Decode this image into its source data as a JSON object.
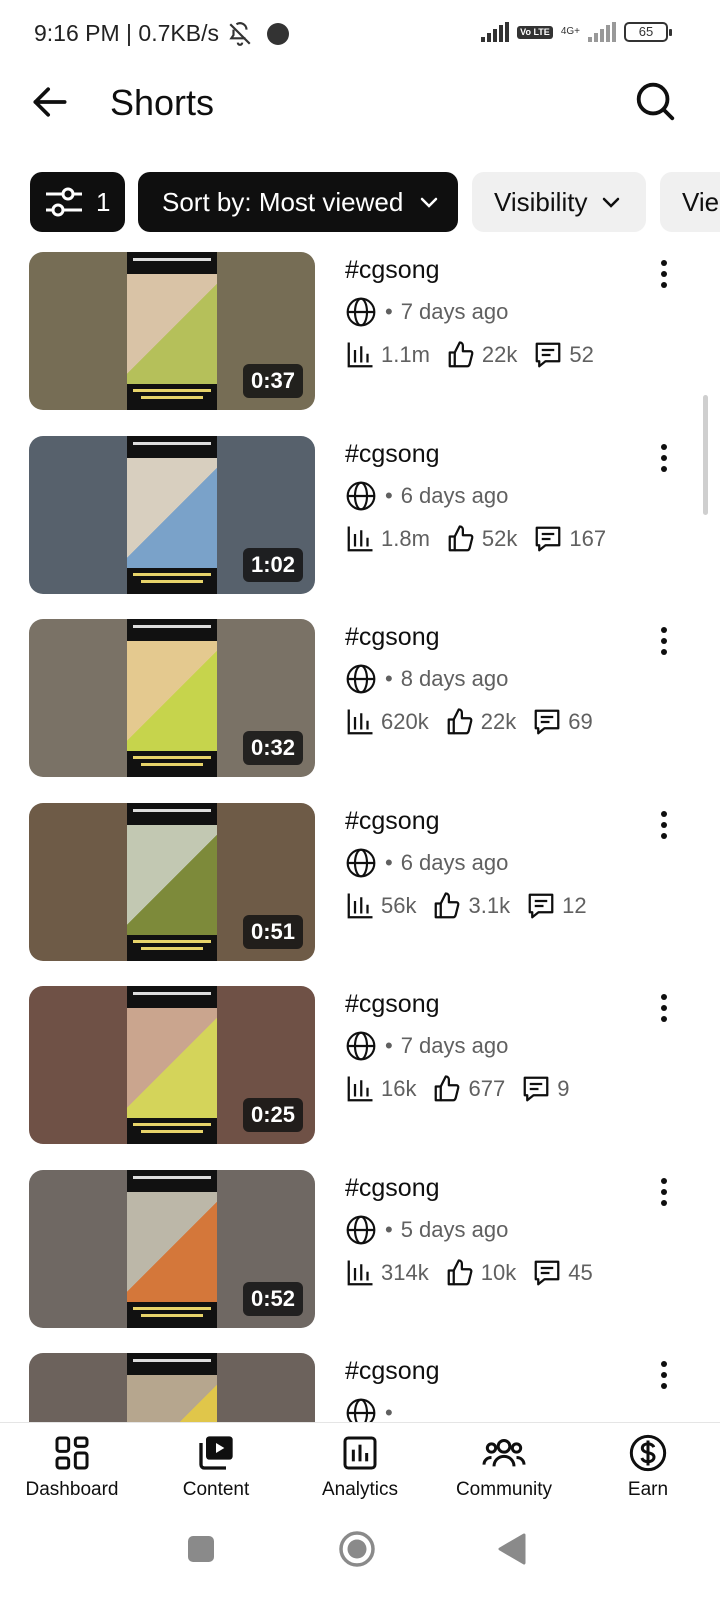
{
  "status_bar": {
    "time_and_speed": "9:16 PM | 0.7KB/s",
    "network": "4G+",
    "volte": "Vo LTE",
    "battery": "65"
  },
  "header": {
    "title": "Shorts"
  },
  "chips": {
    "filter_count": "1",
    "sort_label": "Sort by: Most viewed",
    "visibility_label": "Visibility",
    "views_label": "Vie"
  },
  "videos": [
    {
      "title": "#cgsong",
      "visibility_icon": "globe-icon",
      "age": "7 days ago",
      "duration": "0:37",
      "views": "1.1m",
      "likes": "22k",
      "comments": "52",
      "colors": [
        "#766d55",
        "#d9c3a6",
        "#b5c05a"
      ]
    },
    {
      "title": "#cgsong",
      "visibility_icon": "globe-icon",
      "age": "6 days ago",
      "duration": "1:02",
      "views": "1.8m",
      "likes": "52k",
      "comments": "167",
      "colors": [
        "#57616c",
        "#d8cfbf",
        "#7aa2c9"
      ]
    },
    {
      "title": "#cgsong",
      "visibility_icon": "globe-icon",
      "age": "8 days ago",
      "duration": "0:32",
      "views": "620k",
      "likes": "22k",
      "comments": "69",
      "colors": [
        "#7a7266",
        "#e4c98f",
        "#c6d44c"
      ]
    },
    {
      "title": "#cgsong",
      "visibility_icon": "globe-icon",
      "age": "6 days ago",
      "duration": "0:51",
      "views": "56k",
      "likes": "3.1k",
      "comments": "12",
      "colors": [
        "#6e5b47",
        "#c2c8b2",
        "#7d8a3a"
      ]
    },
    {
      "title": "#cgsong",
      "visibility_icon": "globe-icon",
      "age": "7 days ago",
      "duration": "0:25",
      "views": "16k",
      "likes": "677",
      "comments": "9",
      "colors": [
        "#6f5146",
        "#caa58e",
        "#d4d45a"
      ]
    },
    {
      "title": "#cgsong",
      "visibility_icon": "globe-icon",
      "age": "5 days ago",
      "duration": "0:52",
      "views": "314k",
      "likes": "10k",
      "comments": "45",
      "colors": [
        "#6f6863",
        "#bcb7a8",
        "#d4773a"
      ]
    },
    {
      "title": "#cgsong",
      "visibility_icon": "globe-icon",
      "age": "",
      "duration": "",
      "views": "",
      "likes": "",
      "comments": "",
      "colors": [
        "#6c625c",
        "#b6a68e",
        "#e0c64a"
      ]
    }
  ],
  "bottom_nav": {
    "items": [
      {
        "label": "Dashboard",
        "icon": "dashboard-icon"
      },
      {
        "label": "Content",
        "icon": "content-icon"
      },
      {
        "label": "Analytics",
        "icon": "analytics-icon"
      },
      {
        "label": "Community",
        "icon": "community-icon"
      },
      {
        "label": "Earn",
        "icon": "earn-icon"
      }
    ]
  }
}
